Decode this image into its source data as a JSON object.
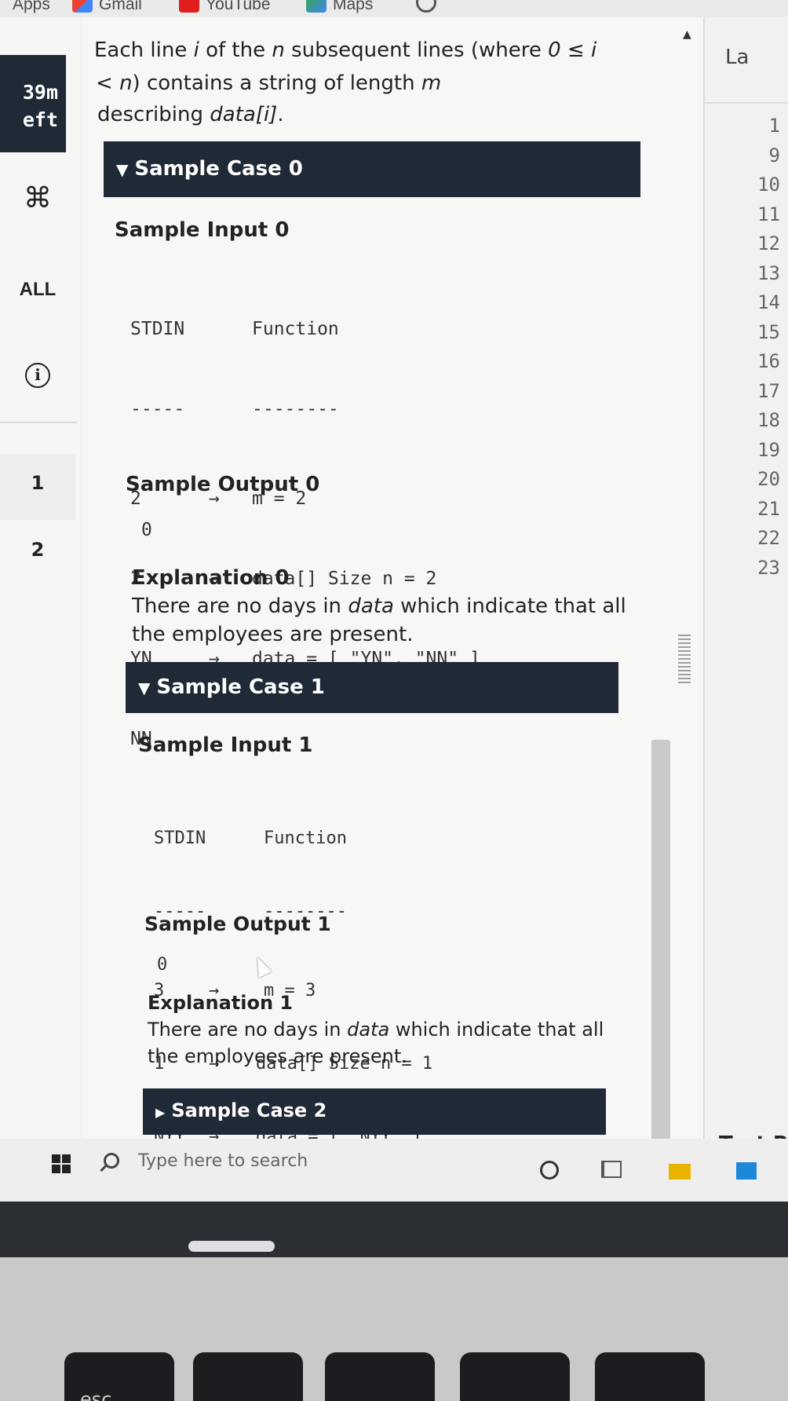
{
  "bookmarks": [
    {
      "label": "Apps",
      "icon": "apps-icon"
    },
    {
      "label": "Gmail",
      "icon": "gmail-icon"
    },
    {
      "label": "YouTube",
      "icon": "youtube-icon"
    },
    {
      "label": "Maps",
      "icon": "maps-icon"
    }
  ],
  "rail": {
    "timer_line1": "39m",
    "timer_line2": "eft",
    "cmd_glyph": "⌘",
    "all_label": "ALL",
    "info_glyph": "i",
    "question_1": "1",
    "question_2": "2"
  },
  "problem": {
    "intro_line1_a": "Each line ",
    "intro_line1_i": "i",
    "intro_line1_b": " of the ",
    "intro_line1_n": "n",
    "intro_line1_c": " subsequent lines (where ",
    "intro_line1_cond": "0 ≤ i",
    "intro_line2_a": "< ",
    "intro_line2_n": "n",
    "intro_line2_b": ") contains a string of length ",
    "intro_line2_m": "m",
    "intro_line3_a": "describing ",
    "intro_line3_data": "data[i]",
    "intro_line3_b": ".",
    "cases": [
      {
        "header": "Sample Case 0",
        "input_title": "Sample Input 0",
        "col_stdin": "STDIN",
        "col_function": "Function",
        "dash_stdin": "-----",
        "dash_function": "--------",
        "rows": [
          {
            "stdin": "2",
            "arrow": "→",
            "fn": "m = 2"
          },
          {
            "stdin": "2",
            "arrow": "→",
            "fn": "data[] Size n = 2"
          },
          {
            "stdin": "YN",
            "arrow": "→",
            "fn": "data = [ \"YN\", \"NN\" ]"
          },
          {
            "stdin": "NN",
            "arrow": "",
            "fn": ""
          }
        ],
        "output_title": "Sample Output 0",
        "output_value": "0",
        "explanation_title": "Explanation 0",
        "explanation_a": "There are no days in ",
        "explanation_data": "data",
        "explanation_b": " which indicate that all",
        "explanation_line2": "the employees are present."
      },
      {
        "header": "Sample Case 1",
        "input_title": "Sample Input 1",
        "col_stdin": "STDIN",
        "col_function": "Function",
        "dash_stdin": "-----",
        "dash_function": "--------",
        "rows": [
          {
            "stdin": "3",
            "arrow": "→",
            "fn": "m = 3"
          },
          {
            "stdin": "1",
            "arrow": "→",
            "fn": "data[] Size n = 1"
          },
          {
            "stdin": "NYY",
            "arrow": "→",
            "fn": "data = [ \"NYY\" ]"
          }
        ],
        "output_title": "Sample Output 1",
        "output_value": "0",
        "explanation_title": "Explanation 1",
        "explanation_a": "There are no days in ",
        "explanation_data": "data",
        "explanation_b": " which indicate that all",
        "explanation_line2": "the employees are present."
      },
      {
        "header": "Sample Case 2"
      }
    ]
  },
  "editor": {
    "language_label": "La",
    "line_numbers": [
      "1",
      "9",
      "10",
      "11",
      "12",
      "13",
      "14",
      "15",
      "16",
      "17",
      "18",
      "19",
      "20",
      "21",
      "22",
      "23"
    ],
    "test_results_label": "Test Re"
  },
  "taskbar": {
    "search_placeholder": "Type here to search"
  },
  "keyboard": {
    "esc_label": "esc"
  },
  "colors": {
    "header_bg": "#1f2a36",
    "panel_bg": "#f7f7f5"
  }
}
